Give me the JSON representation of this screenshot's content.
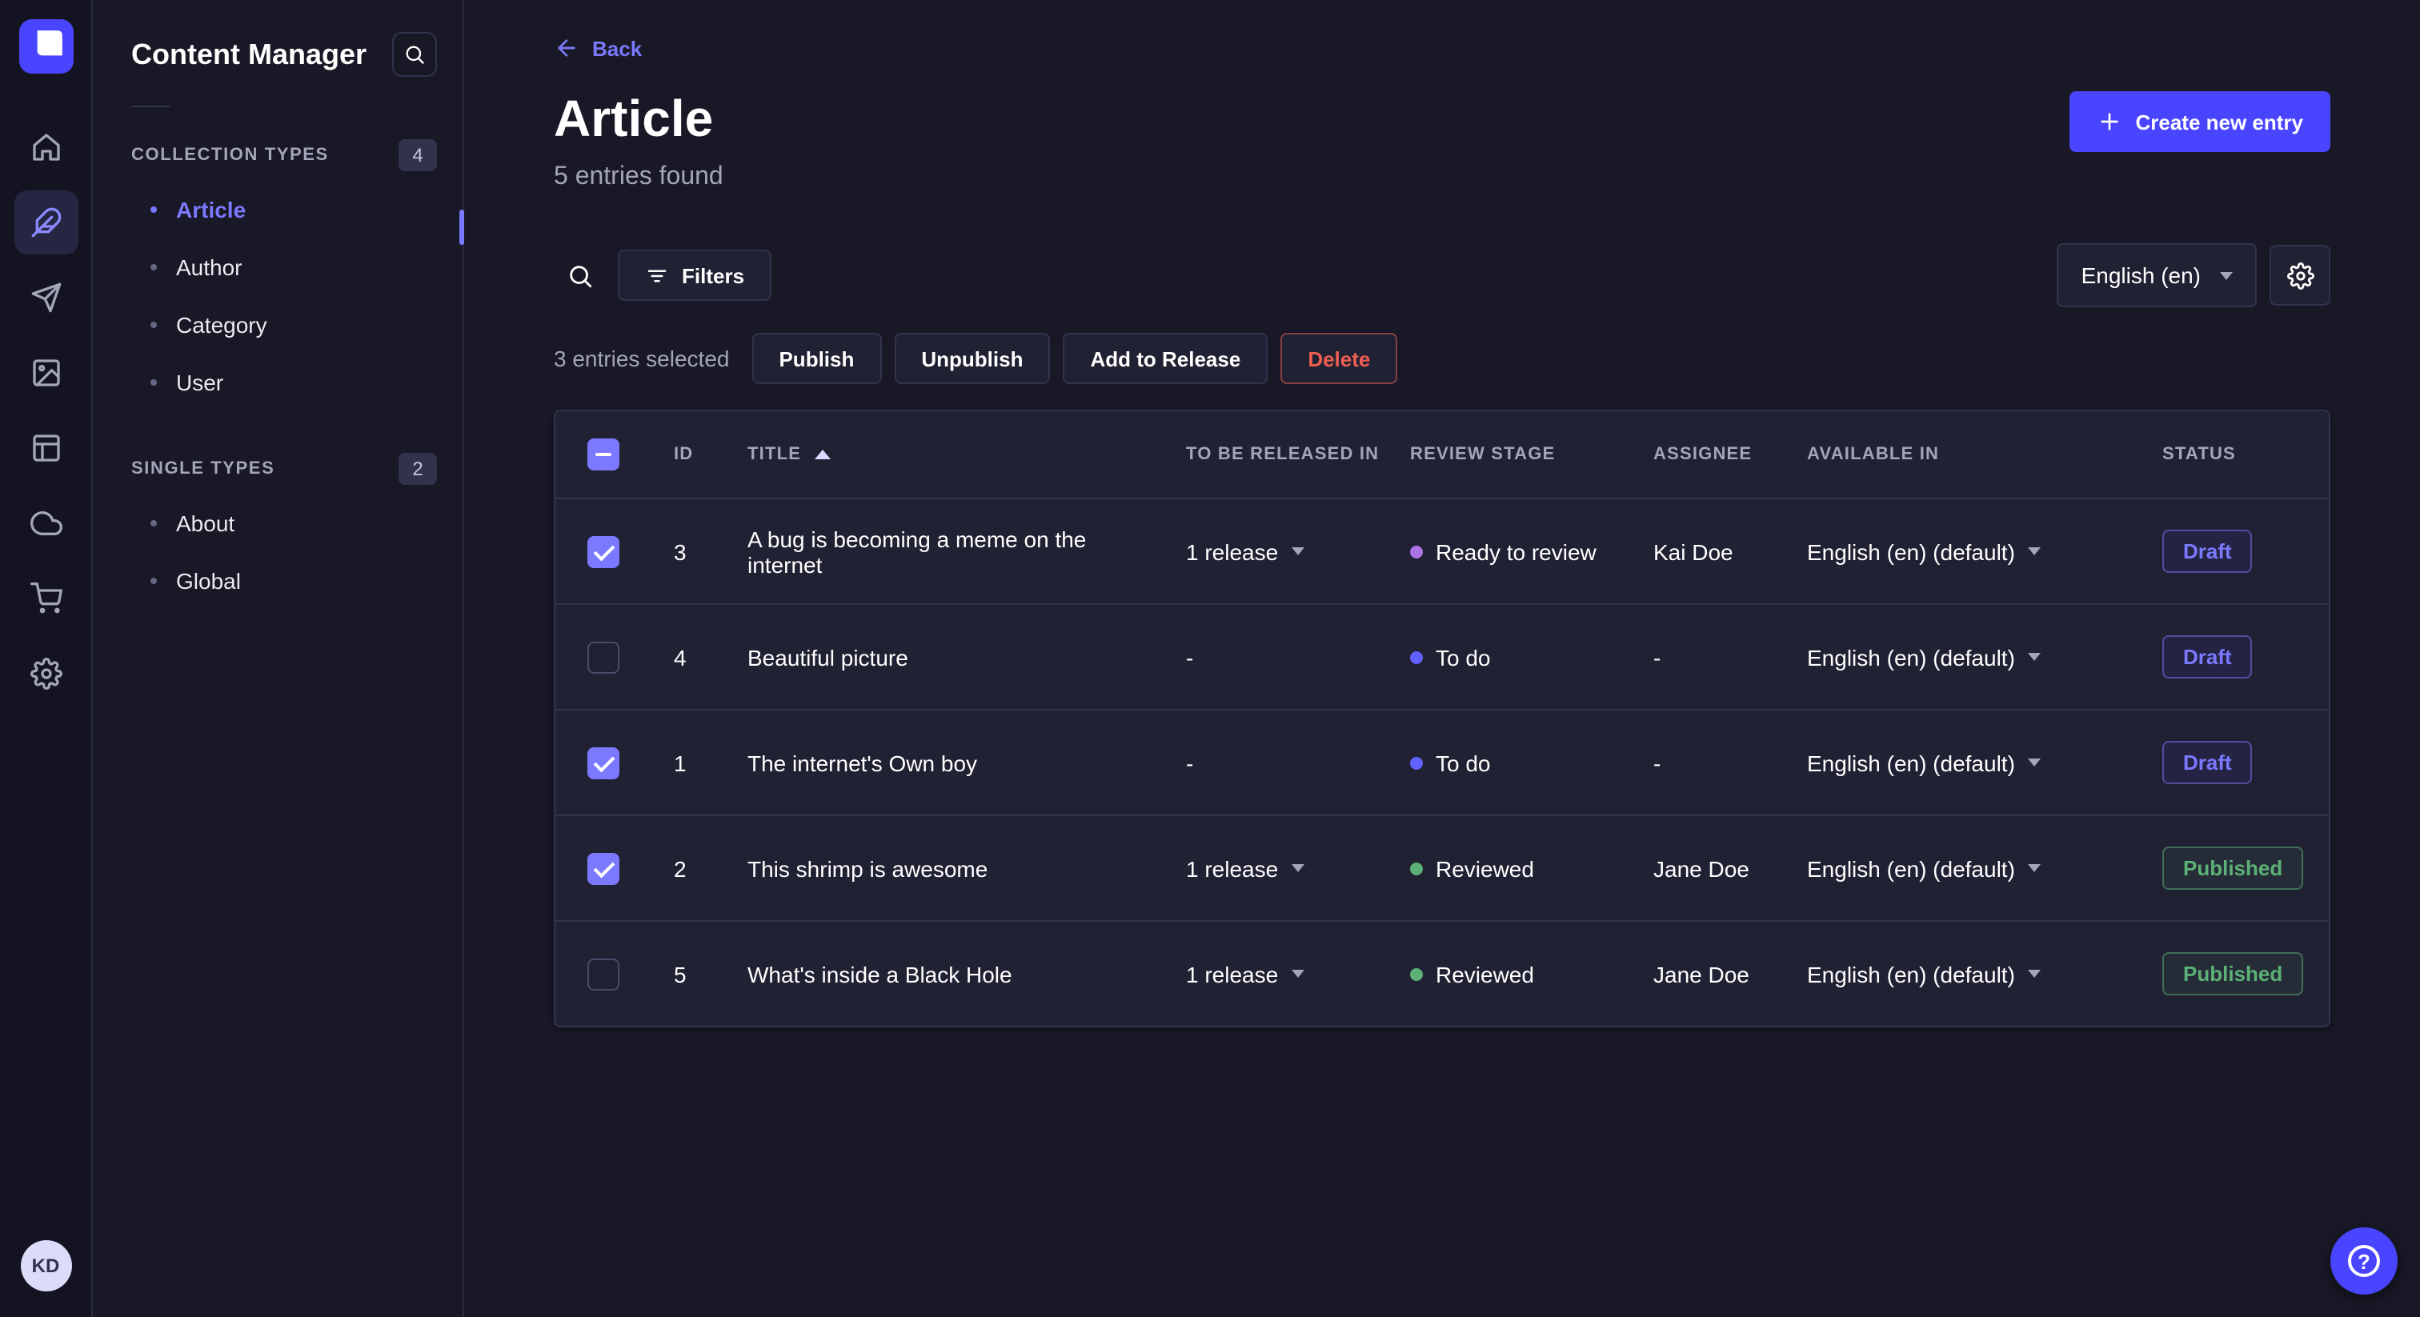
{
  "nav_rail": {
    "icons": [
      "home",
      "content-manager",
      "releases",
      "media-library",
      "content-type-builder",
      "deploy",
      "marketplace",
      "settings"
    ],
    "avatar_initials": "KD"
  },
  "sidebar": {
    "title": "Content Manager",
    "sections": [
      {
        "label": "COLLECTION TYPES",
        "badge": "4",
        "items": [
          {
            "label": "Article",
            "active": true
          },
          {
            "label": "Author",
            "active": false
          },
          {
            "label": "Category",
            "active": false
          },
          {
            "label": "User",
            "active": false
          }
        ]
      },
      {
        "label": "SINGLE TYPES",
        "badge": "2",
        "items": [
          {
            "label": "About",
            "active": false
          },
          {
            "label": "Global",
            "active": false
          }
        ]
      }
    ]
  },
  "header": {
    "back": "Back",
    "title": "Article",
    "subtitle": "5 entries found",
    "create_button": "Create new entry"
  },
  "toolbar": {
    "filters": "Filters",
    "locale": "English (en)"
  },
  "selection": {
    "count_text": "3 entries selected",
    "publish": "Publish",
    "unpublish": "Unpublish",
    "add_to_release": "Add to Release",
    "delete": "Delete"
  },
  "table": {
    "select_all": "mixed",
    "headers": {
      "id": "ID",
      "title": "TITLE",
      "release": "TO BE RELEASED IN",
      "stage": "REVIEW STAGE",
      "assignee": "ASSIGNEE",
      "available": "AVAILABLE IN",
      "status": "STATUS"
    },
    "rows": [
      {
        "checked": true,
        "id": "3",
        "title": "A bug is becoming a meme on the internet",
        "release": "1 release",
        "stage": "Ready to review",
        "stage_color": "#ac73e6",
        "assignee": "Kai Doe",
        "available": "English (en) (default)",
        "status": "Draft",
        "variant": "draft"
      },
      {
        "checked": false,
        "id": "4",
        "title": "Beautiful picture",
        "release": "-",
        "stage": "To do",
        "stage_color": "#6161ff",
        "assignee": "-",
        "available": "English (en) (default)",
        "status": "Draft",
        "variant": "draft"
      },
      {
        "checked": true,
        "id": "1",
        "title": "The internet's Own boy",
        "release": "-",
        "stage": "To do",
        "stage_color": "#6161ff",
        "assignee": "-",
        "available": "English (en) (default)",
        "status": "Draft",
        "variant": "draft"
      },
      {
        "checked": true,
        "id": "2",
        "title": "This shrimp is awesome",
        "release": "1 release",
        "stage": "Reviewed",
        "stage_color": "#5cb176",
        "assignee": "Jane Doe",
        "available": "English (en) (default)",
        "status": "Published",
        "variant": "published"
      },
      {
        "checked": false,
        "id": "5",
        "title": "What's inside a Black Hole",
        "release": "1 release",
        "stage": "Reviewed",
        "stage_color": "#5cb176",
        "assignee": "Jane Doe",
        "available": "English (en) (default)",
        "status": "Published",
        "variant": "published"
      }
    ]
  },
  "colors": {
    "accent": "#4945ff",
    "accent_light": "#7b79ff",
    "success": "#5cb176",
    "danger": "#ee5e52"
  }
}
